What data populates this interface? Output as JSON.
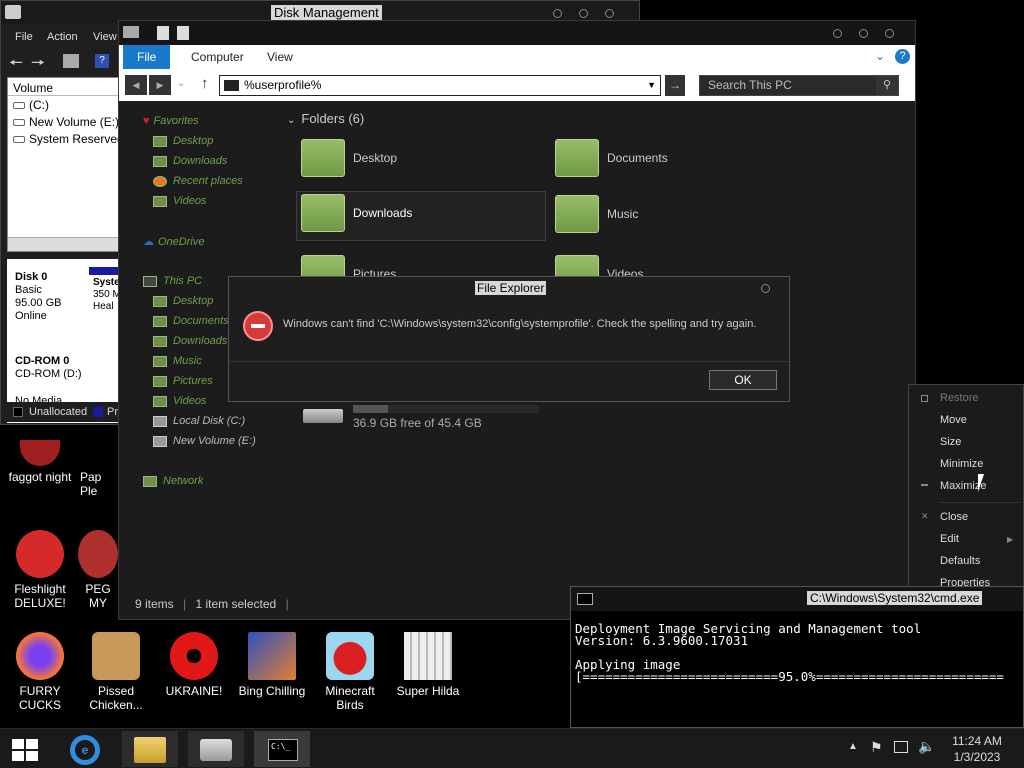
{
  "desktop": {
    "icons": [
      {
        "label": "faggot night"
      },
      {
        "label": "Pap\nPle"
      },
      {
        "label": "Fleshlight\nDELUXE!"
      },
      {
        "label": "PEG MY"
      },
      {
        "label": "FURRY CUCKS"
      },
      {
        "label": "Pissed\nChicken..."
      },
      {
        "label": "UKRAINE!"
      },
      {
        "label": "Bing Chilling"
      },
      {
        "label": "Minecraft\nBirds"
      },
      {
        "label": "Super Hilda"
      }
    ]
  },
  "disk_management": {
    "title": "Disk Management",
    "menu": [
      "File",
      "Action",
      "View"
    ],
    "volume_header": "Volume",
    "volumes": [
      "(C:)",
      "New Volume (E:)",
      "System Reserved"
    ],
    "disk0": {
      "name": "Disk 0",
      "type": "Basic",
      "size": "95.00 GB",
      "status": "Online",
      "part_name": "Syste",
      "part_size": "350 M",
      "part_state": "Heal"
    },
    "cdrom": {
      "name": "CD-ROM 0",
      "drive": "CD-ROM (D:)",
      "media": "No Media"
    },
    "legend": {
      "unallocated": "Unallocated",
      "primary": "Pr"
    }
  },
  "explorer": {
    "tabs": {
      "file": "File",
      "computer": "Computer",
      "view": "View"
    },
    "address": "%userprofile%",
    "search_placeholder": "Search This PC",
    "nav": {
      "favorites": "Favorites",
      "fav_items": [
        "Desktop",
        "Downloads",
        "Recent places",
        "Videos"
      ],
      "onedrive": "OneDrive",
      "thispc": "This PC",
      "pc_items": [
        "Desktop",
        "Documents",
        "Downloads",
        "Music",
        "Pictures",
        "Videos",
        "Local Disk (C:)",
        "New Volume (E:)"
      ],
      "network": "Network"
    },
    "folders_header": "Folders (6)",
    "folders": [
      "Desktop",
      "Documents",
      "Downloads",
      "Music",
      "Pictures",
      "Videos"
    ],
    "drive_free": "36.9 GB free of 45.4 GB",
    "status": {
      "items": "9 items",
      "selected": "1 item selected"
    }
  },
  "error_dialog": {
    "title": "File Explorer",
    "message": "Windows can't find 'C:\\Windows\\system32\\config\\systemprofile'. Check the spelling and try again.",
    "ok": "OK"
  },
  "context_menu": {
    "items": [
      "Restore",
      "Move",
      "Size",
      "Minimize",
      "Maximize",
      "Close",
      "Edit",
      "Defaults",
      "Properties"
    ]
  },
  "cmd": {
    "title": "C:\\Windows\\System32\\cmd.exe",
    "line1": "Deployment Image Servicing and Management tool",
    "line2": "Version: 6.3.9600.17031",
    "line3": "Applying image",
    "line4": "[==========================95.0%=========================",
    "progress": 95.0
  },
  "taskbar": {
    "time": "11:24 AM",
    "date": "1/3/2023"
  },
  "colors": {
    "accent": "#1979ca",
    "folder_green": "#8fb65f",
    "error_red": "#d43b3b"
  }
}
